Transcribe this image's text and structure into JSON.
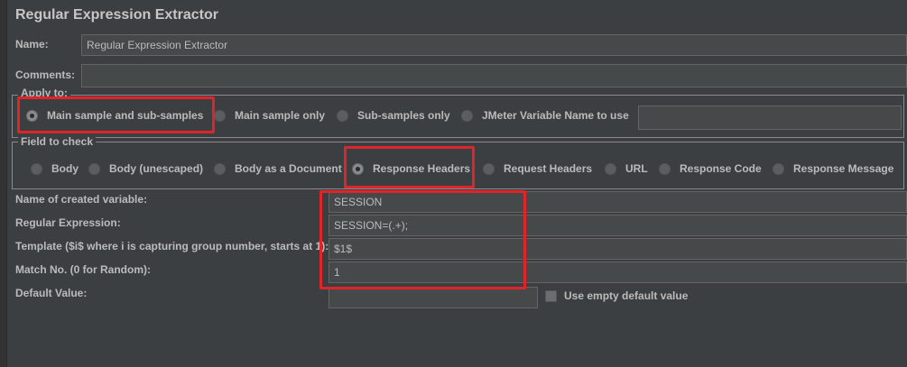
{
  "panel": {
    "title": "Regular Expression Extractor"
  },
  "name": {
    "label": "Name:",
    "value": "Regular Expression Extractor"
  },
  "comments": {
    "label": "Comments:",
    "value": ""
  },
  "apply_to": {
    "legend": "Apply to:",
    "options": [
      {
        "label": "Main sample and sub-samples",
        "selected": true
      },
      {
        "label": "Main sample only",
        "selected": false
      },
      {
        "label": "Sub-samples only",
        "selected": false
      },
      {
        "label": "JMeter Variable Name to use",
        "selected": false
      }
    ],
    "variable_value": ""
  },
  "field_to_check": {
    "legend": "Field to check",
    "options": [
      {
        "label": "Body",
        "selected": false
      },
      {
        "label": "Body (unescaped)",
        "selected": false
      },
      {
        "label": "Body as a Document",
        "selected": false
      },
      {
        "label": "Response Headers",
        "selected": true
      },
      {
        "label": "Request Headers",
        "selected": false
      },
      {
        "label": "URL",
        "selected": false
      },
      {
        "label": "Response Code",
        "selected": false
      },
      {
        "label": "Response Message",
        "selected": false
      }
    ]
  },
  "fields": {
    "variable_name": {
      "label": "Name of created variable:",
      "value": "SESSION"
    },
    "regex": {
      "label": "Regular Expression:",
      "value": "SESSION=(.+);"
    },
    "template": {
      "label": "Template ($i$ where i is capturing group number, starts at 1):",
      "value": "$1$"
    },
    "match_no": {
      "label": "Match No. (0 for Random):",
      "value": "1"
    },
    "default_value": {
      "label": "Default Value:",
      "value": ""
    }
  },
  "use_empty_default": {
    "label": "Use empty default value",
    "checked": false
  },
  "colors": {
    "background": "#3c3f41",
    "field": "#45494a",
    "highlight": "#e0242a"
  }
}
